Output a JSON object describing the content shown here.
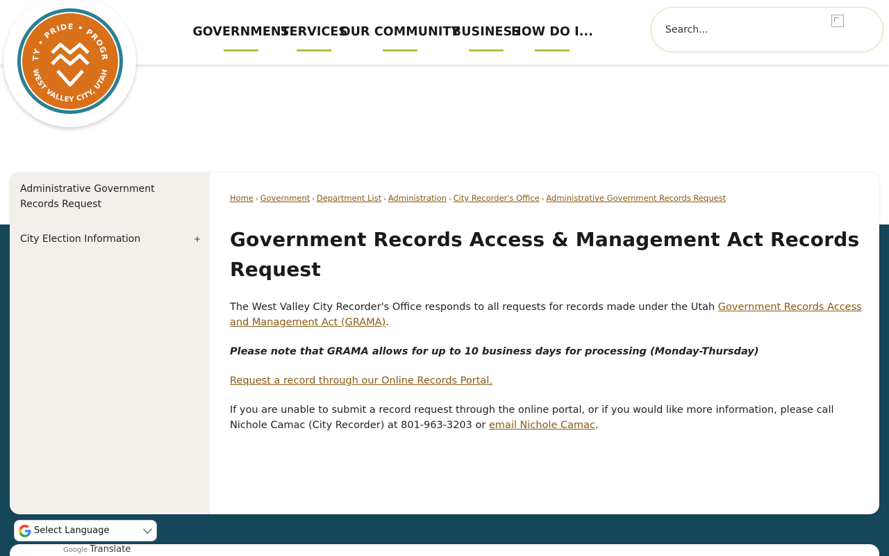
{
  "nav": {
    "items": [
      {
        "label": "GOVERNMENT"
      },
      {
        "label": "SERVICES"
      },
      {
        "label": "OUR COMMUNITY"
      },
      {
        "label": "BUSINESS"
      },
      {
        "label": "HOW DO I..."
      }
    ]
  },
  "logo": {
    "ring_top": "UNITY • PRIDE • PROGRESS",
    "ring_bottom": "WEST VALLEY CITY, UTAH"
  },
  "search": {
    "placeholder": "Search..."
  },
  "sidebar": {
    "items": [
      {
        "label": "Administrative Government Records Request"
      },
      {
        "label": "City Election Information",
        "toggle": "+"
      }
    ]
  },
  "breadcrumb": {
    "items": [
      "Home",
      "Government",
      "Department List",
      "Administration",
      "City Recorder's Office",
      "Administrative Government Records Request"
    ],
    "separator": "›"
  },
  "main": {
    "title": "Government Records Access & Management Act Records Request",
    "p1_text": "The West Valley City Recorder's Office responds to all requests for records made under the Utah ",
    "p1_link": "Government Records Access and Management Act (GRAMA)",
    "p1_end": ".",
    "note": "Please note that GRAMA allows for up to 10 business days for processing (Monday-Thursday)",
    "portal_link": "Request a record through our Online Records Portal.",
    "p3_text": "If you are unable to submit a record request through the online portal, or if you would like more information, please call Nichole Camac (City Recorder) at 801-963-3203 or ",
    "p3_link": "email Nichole Camac",
    "p3_end": "."
  },
  "translate": {
    "select_label": "Select Language",
    "powered_google": "Google",
    "powered_label": "Translate"
  },
  "colors": {
    "accent_bar": "#b5c23d",
    "teal": "#15465a",
    "logo_orange": "#d9701a",
    "logo_teal": "#2a7f92",
    "link": "#8a5a12"
  }
}
